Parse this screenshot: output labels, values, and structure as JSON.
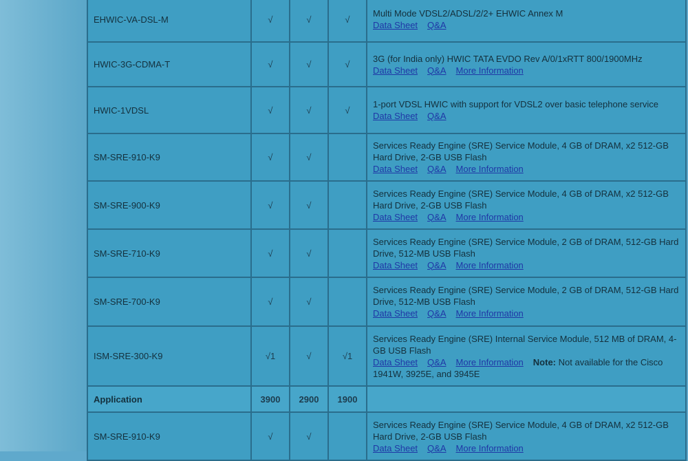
{
  "header": {
    "application": "Application",
    "cols": [
      "3900",
      "2900",
      "1900"
    ]
  },
  "links": {
    "data_sheet": "Data Sheet",
    "qa": "Q&A",
    "more": "More Information"
  },
  "rows": [
    {
      "name": "EHWIC-VA-DSL-M",
      "c1": "√",
      "c2": "√",
      "c3": "√",
      "desc": "Multi Mode VDSL2/ADSL/2/2+ EHWIC Annex M",
      "more": false
    },
    {
      "name": "HWIC-3G-CDMA-T",
      "c1": "√",
      "c2": "√",
      "c3": "√",
      "desc": "3G (for India only) HWIC TATA EVDO Rev A/0/1xRTT 800/1900MHz",
      "more": true
    },
    {
      "name": "HWIC-1VDSL",
      "c1": "√",
      "c2": "√",
      "c3": "√",
      "desc": "1-port VDSL HWIC with support for VDSL2 over basic telephone service",
      "more": false
    },
    {
      "name": "SM-SRE-910-K9",
      "c1": "√",
      "c2": "√",
      "c3": "",
      "desc": "Services Ready Engine (SRE) Service Module, 4 GB of DRAM, x2 512-GB Hard Drive, 2-GB USB Flash",
      "more": true
    },
    {
      "name": "SM-SRE-900-K9",
      "c1": "√",
      "c2": "√",
      "c3": "",
      "desc": "Services Ready Engine (SRE) Service Module, 4 GB of DRAM, x2 512-GB Hard Drive, 2-GB USB Flash",
      "more": true
    },
    {
      "name": "SM-SRE-710-K9",
      "c1": "√",
      "c2": "√",
      "c3": "",
      "desc": "Services Ready Engine (SRE) Service Module, 2 GB of DRAM, 512-GB Hard Drive, 512-MB USB Flash",
      "more": true
    },
    {
      "name": "SM-SRE-700-K9",
      "c1": "√",
      "c2": "√",
      "c3": "",
      "desc": "Services Ready Engine (SRE) Service Module, 2 GB of DRAM, 512-GB Hard Drive, 512-MB USB Flash",
      "more": true
    },
    {
      "name": "ISM-SRE-300-K9",
      "c1": "√1",
      "c2": "√",
      "c3": "√1",
      "desc": "Services Ready Engine (SRE) Internal Service Module, 512 MB of DRAM, 4-GB USB Flash",
      "more": true,
      "note_label": "Note:",
      "note": "Not available for the Cisco 1941W, 3925E, and 3945E"
    }
  ],
  "rows_after": [
    {
      "name": "SM-SRE-910-K9",
      "c1": "√",
      "c2": "√",
      "c3": "",
      "desc": "Services Ready Engine (SRE) Service Module, 4 GB of DRAM, x2 512-GB Hard Drive, 2-GB USB Flash",
      "more": true
    }
  ]
}
